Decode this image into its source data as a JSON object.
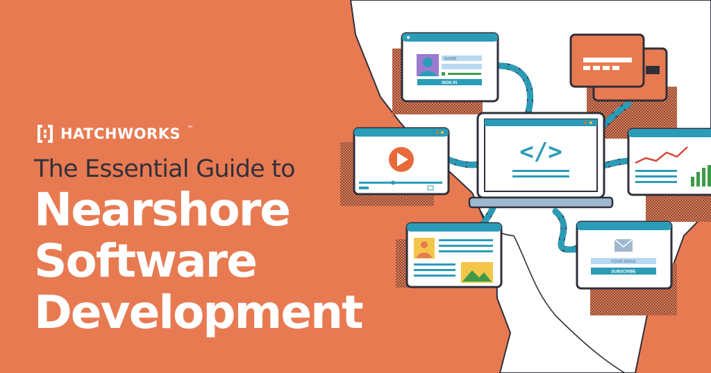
{
  "brand": {
    "name": "HATCHWORKS",
    "trademark": "™"
  },
  "headline": {
    "subtitle": "The Essential Guide to",
    "title_lines": [
      "Nearshore",
      "Software",
      "Development"
    ]
  },
  "illustration": {
    "signin_card": {
      "name_placeholder": "NAME",
      "button_label": "SIGN IN"
    },
    "code_symbol": "</>",
    "subscribe_card": {
      "email_placeholder": "YOUR EMAIL",
      "button_label": "SUBSCRIBE"
    }
  },
  "colors": {
    "background": "#E87A52",
    "land": "#FFFFFF",
    "outline": "#2F2F3A",
    "accent": "#2B9CB8",
    "play": "#E86A3A",
    "chart_red": "#D9453B",
    "chart_green": "#3E9A48"
  }
}
